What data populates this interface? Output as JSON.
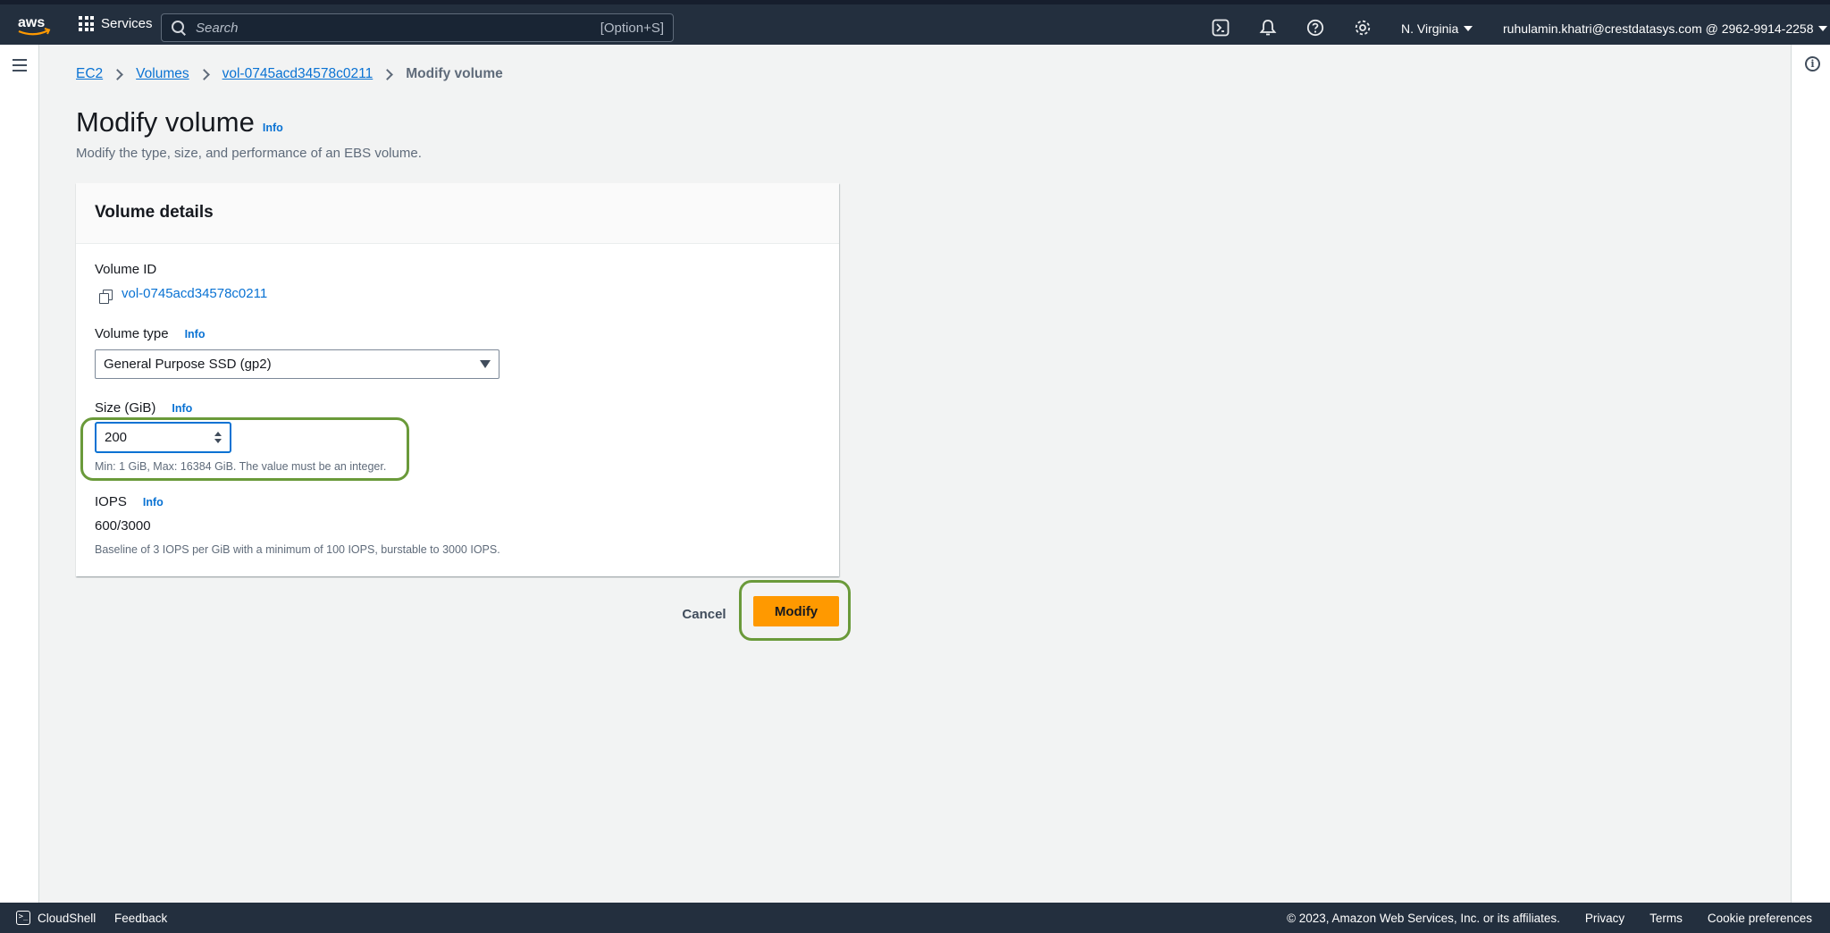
{
  "topnav": {
    "services_label": "Services",
    "search_placeholder": "Search",
    "search_shortcut": "[Option+S]",
    "region": "N. Virginia",
    "account": "ruhulamin.khatri@crestdatasys.com @ 2962-9914-2258"
  },
  "breadcrumb": {
    "items": [
      "EC2",
      "Volumes",
      "vol-0745acd34578c0211"
    ],
    "current": "Modify volume"
  },
  "page": {
    "title": "Modify volume",
    "info": "Info",
    "subtitle": "Modify the type, size, and performance of an EBS volume."
  },
  "panel": {
    "header": "Volume details",
    "volume_id_label": "Volume ID",
    "volume_id": "vol-0745acd34578c0211",
    "volume_type_label": "Volume type",
    "volume_type_info": "Info",
    "volume_type_value": "General Purpose SSD (gp2)",
    "size_label": "Size (GiB)",
    "size_info": "Info",
    "size_value": "200",
    "size_hint": "Min: 1 GiB, Max: 16384 GiB. The value must be an integer.",
    "iops_label": "IOPS",
    "iops_info": "Info",
    "iops_value": "600/3000",
    "iops_hint": "Baseline of 3 IOPS per GiB with a minimum of 100 IOPS, burstable to 3000 IOPS."
  },
  "actions": {
    "cancel": "Cancel",
    "modify": "Modify"
  },
  "footer": {
    "cloudshell": "CloudShell",
    "feedback": "Feedback",
    "copyright": "© 2023, Amazon Web Services, Inc. or its affiliates.",
    "privacy": "Privacy",
    "terms": "Terms",
    "cookies": "Cookie preferences"
  },
  "colors": {
    "nav_bg": "#232f3e",
    "link": "#0972d3",
    "primary_button": "#ff9900",
    "highlight": "#6a9a3a"
  },
  "icons": [
    "aws-logo",
    "apps-grid-icon",
    "search-icon",
    "cloudshell-icon",
    "bell-icon",
    "help-icon",
    "gear-icon",
    "hamburger-icon",
    "info-circle-icon",
    "copy-icon"
  ]
}
